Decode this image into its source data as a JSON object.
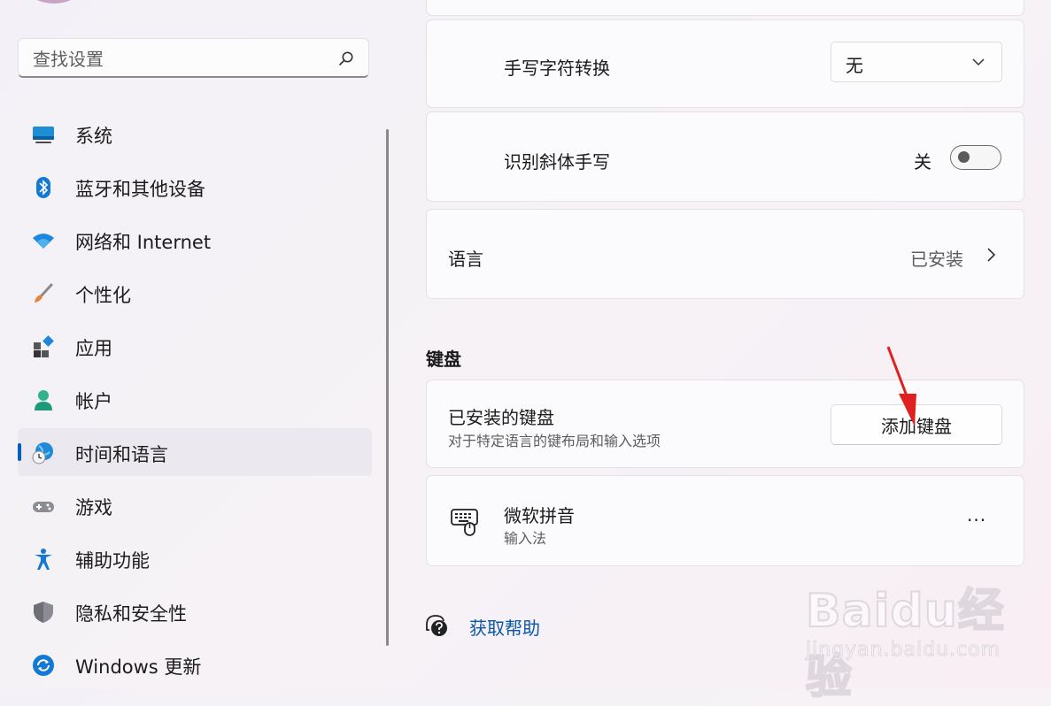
{
  "search": {
    "placeholder": "查找设置"
  },
  "sidebar": {
    "items": [
      {
        "label": "系统",
        "icon": "system-icon"
      },
      {
        "label": "蓝牙和其他设备",
        "icon": "bluetooth-icon"
      },
      {
        "label": "网络和 Internet",
        "icon": "wifi-icon"
      },
      {
        "label": "个性化",
        "icon": "brush-icon"
      },
      {
        "label": "应用",
        "icon": "apps-icon"
      },
      {
        "label": "帐户",
        "icon": "account-icon"
      },
      {
        "label": "时间和语言",
        "icon": "globe-clock-icon",
        "selected": true
      },
      {
        "label": "游戏",
        "icon": "gamepad-icon"
      },
      {
        "label": "辅助功能",
        "icon": "accessibility-icon"
      },
      {
        "label": "隐私和安全性",
        "icon": "shield-icon"
      },
      {
        "label": "Windows 更新",
        "icon": "update-icon"
      }
    ]
  },
  "main": {
    "handwriting_conversion": {
      "label": "手写字符转换",
      "value": "无"
    },
    "italic_handwriting": {
      "label": "识别斜体手写",
      "state_label": "关",
      "on": false
    },
    "language": {
      "label": "语言",
      "value": "已安装"
    },
    "keyboard_section": {
      "header": "键盘",
      "installed": {
        "title": "已安装的键盘",
        "subtitle": "对于特定语言的键布局和输入选项",
        "button": "添加键盘"
      },
      "ime": {
        "title": "微软拼音",
        "subtitle": "输入法",
        "more": "···"
      }
    },
    "help": {
      "label": "获取帮助"
    }
  },
  "watermark": {
    "logo": "Baidu经验",
    "url": "jingyan.baidu.com"
  },
  "colors": {
    "accent": "#005fb8",
    "link": "#0b57a7",
    "annotation": "#e0201f"
  }
}
